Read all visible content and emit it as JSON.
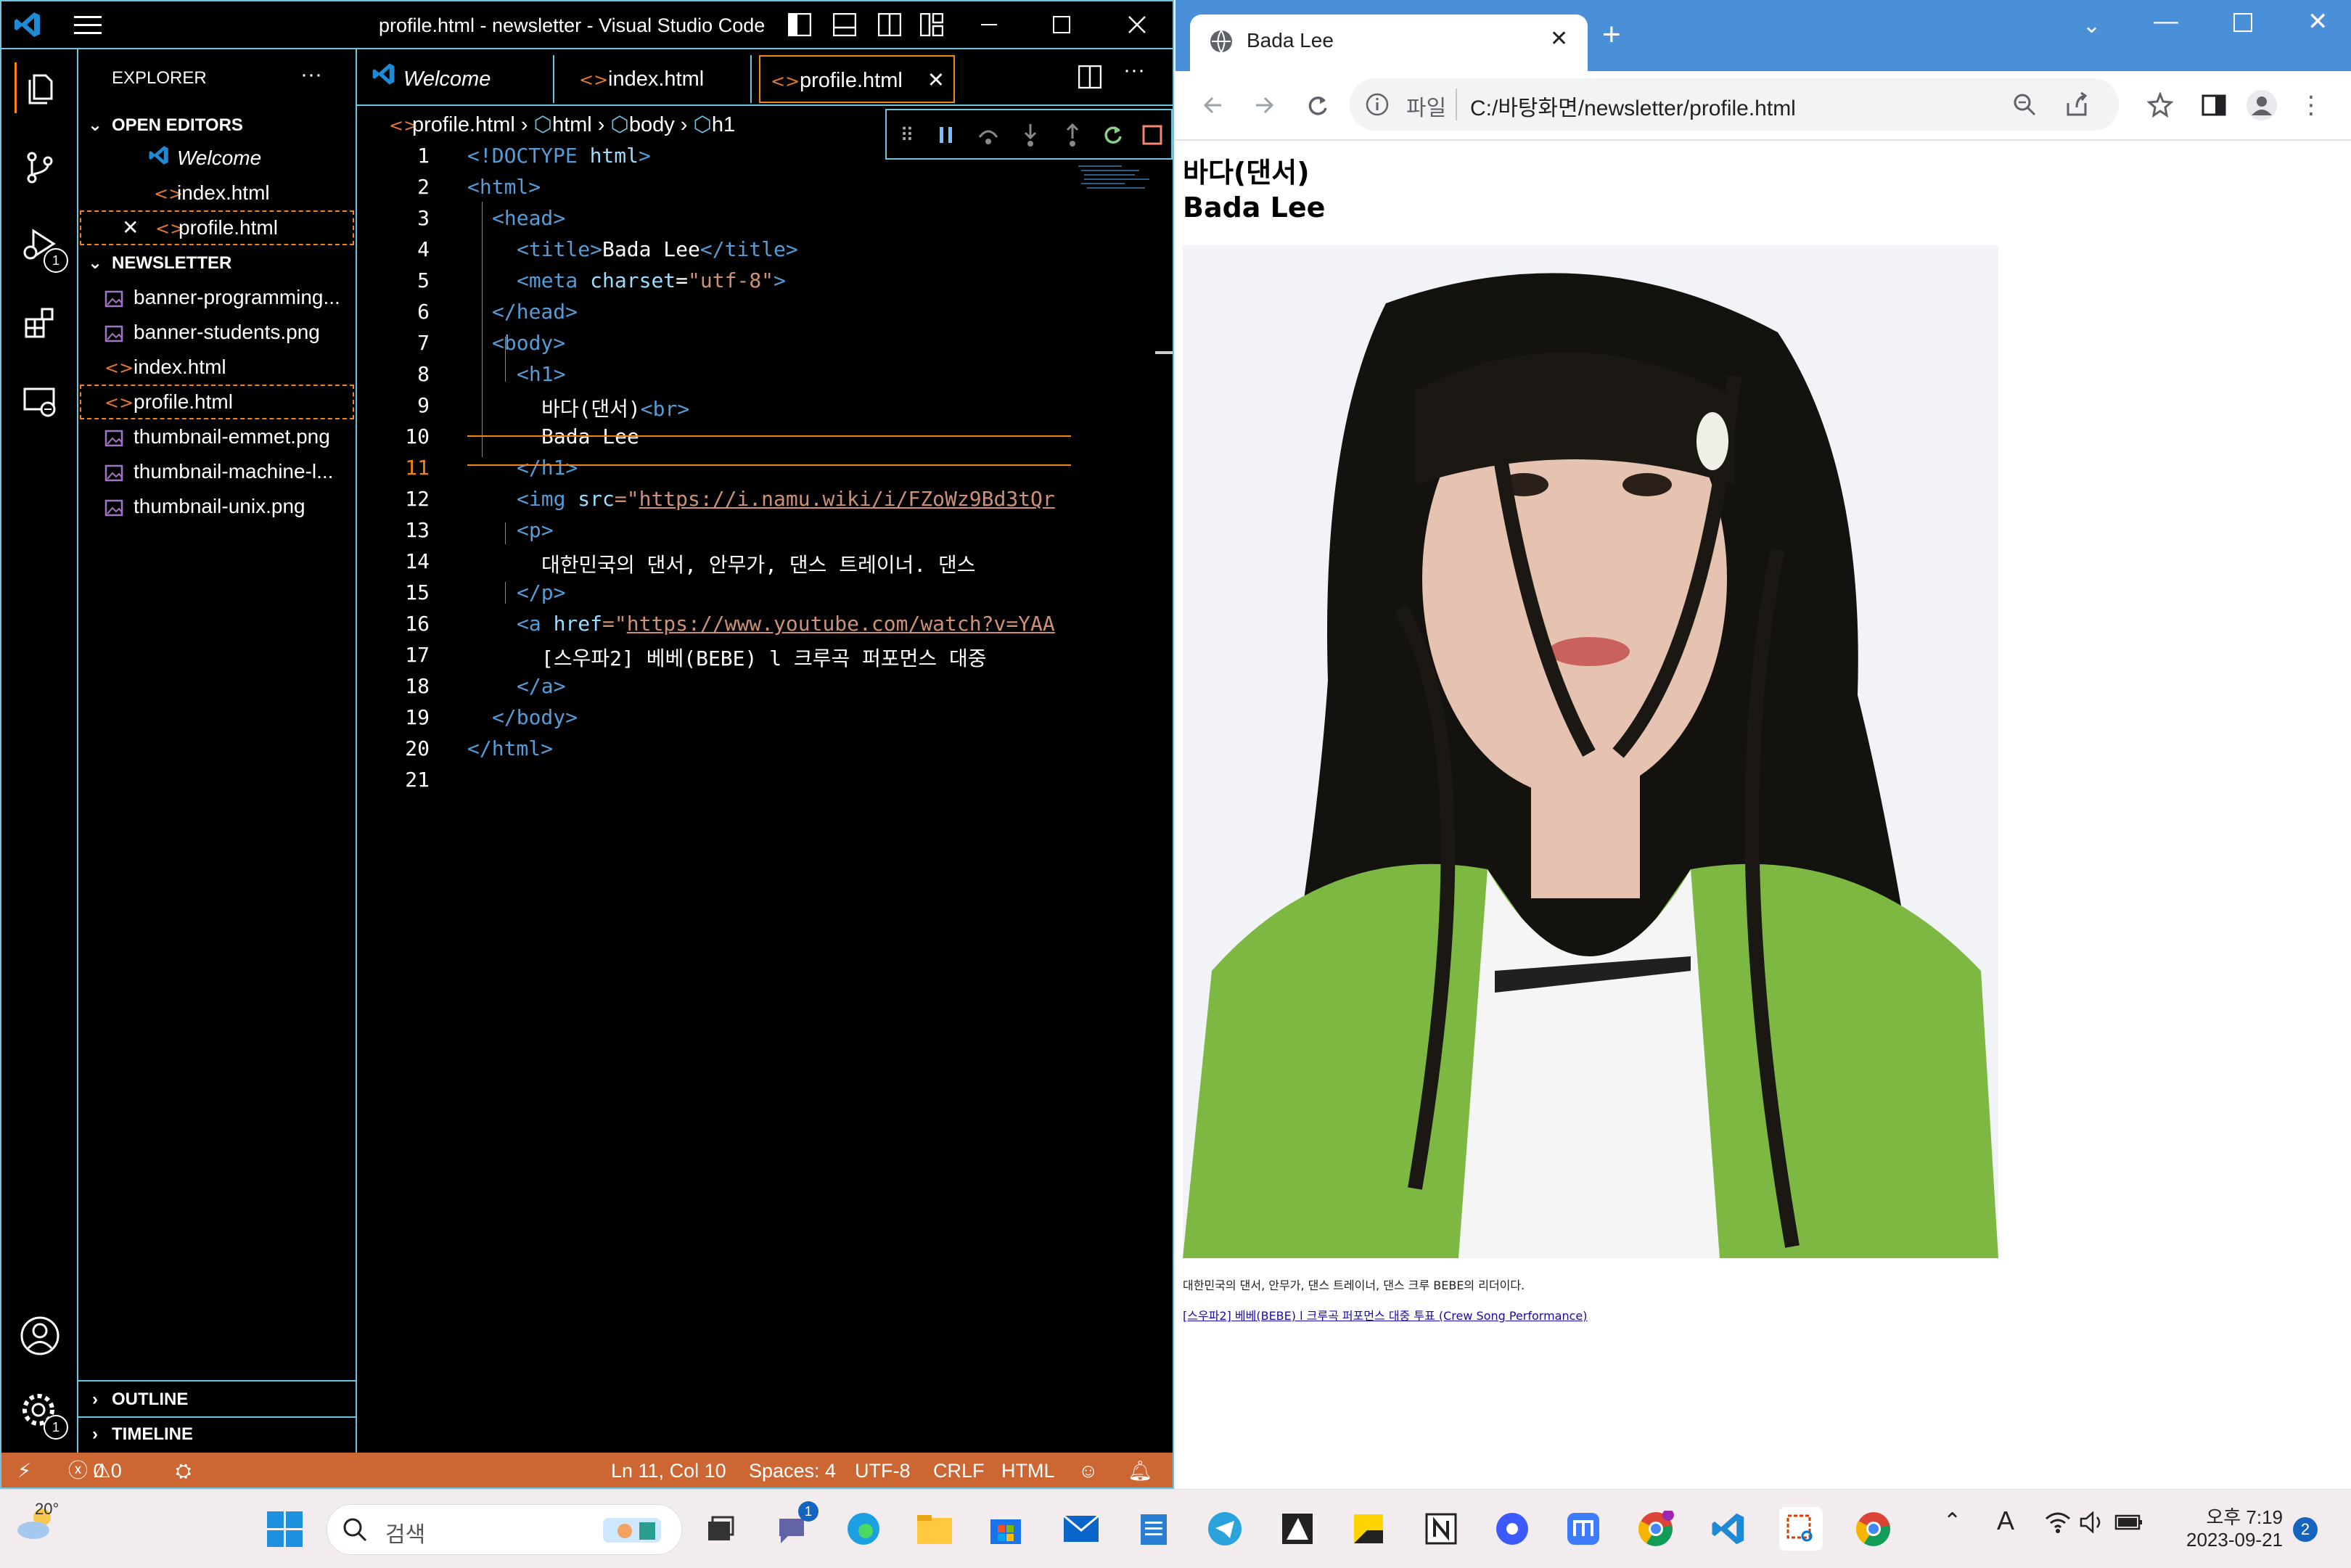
{
  "vscode": {
    "title": "profile.html - newsletter - Visual Studio Code",
    "sidebar": {
      "header": "EXPLORER",
      "open_editors_title": "OPEN EDITORS",
      "open_editors": [
        "Welcome",
        "index.html",
        "profile.html"
      ],
      "folder_title": "NEWSLETTER",
      "files": [
        "banner-programming...",
        "banner-students.png",
        "index.html",
        "profile.html",
        "thumbnail-emmet.png",
        "thumbnail-machine-l...",
        "thumbnail-unix.png"
      ],
      "outline_title": "OUTLINE",
      "timeline_title": "TIMELINE"
    },
    "tabs": [
      "Welcome",
      "index.html",
      "profile.html"
    ],
    "breadcrumb": [
      "profile.html",
      "html",
      "body",
      "h1"
    ],
    "line_numbers": [
      "1",
      "2",
      "3",
      "4",
      "5",
      "6",
      "7",
      "8",
      "9",
      "10",
      "11",
      "12",
      "13",
      "14",
      "15",
      "16",
      "17",
      "18",
      "19",
      "20",
      "21"
    ],
    "code": {
      "l1a": "<!DOCTYPE",
      "l1b": "html",
      "l1c": ">",
      "l2": "<html>",
      "l3": "<head>",
      "l4a": "<title>",
      "l4b": "Bada Lee",
      "l4c": "</title>",
      "l5a": "<meta",
      "l5b": "charset",
      "l5c": "=",
      "l5d": "\"utf-8\"",
      "l5e": ">",
      "l6": "</head>",
      "l7": "<body>",
      "l8": "<h1>",
      "l9a": "바다(댄서)",
      "l9b": "<br>",
      "l10": "Bada Lee",
      "l11": "</h1>",
      "l12a": "<img",
      "l12b": "src",
      "l12c": "=\"",
      "l12d": "https://i.namu.wiki/i/FZoWz9Bd3tQr",
      "l13": "<p>",
      "l14": "대한민국의 댄서, 안무가, 댄스 트레이너. 댄스",
      "l15": "</p>",
      "l16a": "<a",
      "l16b": "href",
      "l16c": "=\"",
      "l16d": "https://www.youtube.com/watch?v=YAA",
      "l17": "[스우파2] 베베(BEBE) l 크루곡 퍼포먼스 대중",
      "l18": "</a>",
      "l19": "</body>",
      "l20": "</html>"
    },
    "status": {
      "errors": "0",
      "warnings": "0",
      "position": "Ln 11, Col 10",
      "spaces": "Spaces: 4",
      "encoding": "UTF-8",
      "eol": "CRLF",
      "language": "HTML"
    },
    "activity_badges": {
      "debug": "1",
      "settings": "1"
    }
  },
  "chrome": {
    "tab_title": "Bada Lee",
    "address_scheme": "파일",
    "address_url": "C:/바탕화면/newsletter/profile.html",
    "page": {
      "h1_line1": "바다(댄서)",
      "h1_line2": "Bada Lee",
      "paragraph": "대한민국의 댄서, 안무가, 댄스 트레이너, 댄스 크루 BEBE의 리더이다.",
      "link": "[스우파2] 베베(BEBE) l 크루곡 퍼포먼스 대중 투표 (Crew Song Performance)"
    }
  },
  "taskbar": {
    "weather": "20°",
    "search_placeholder": "검색",
    "chat_badge": "1",
    "time": "오후 7:19",
    "date": "2023-09-21",
    "notification_count": "2",
    "ime": "A"
  },
  "colors": {
    "hc_border": "#6fc3df",
    "hc_active": "#f38518",
    "status_bg": "#cc6633",
    "chrome_frame": "#4a90d9"
  }
}
